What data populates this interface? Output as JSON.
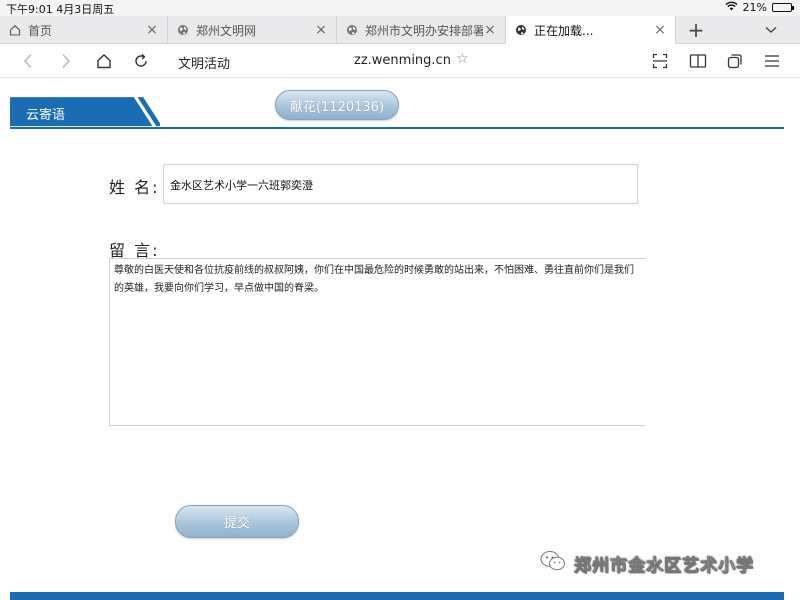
{
  "status_bar": {
    "time_date": "下午9:01   4月3日周五",
    "battery": "21%",
    "battery_level": 0.21
  },
  "tabs": [
    {
      "title": "首页",
      "icon": "home-icon",
      "active": false
    },
    {
      "title": "郑州文明网",
      "icon": "globe-icon",
      "active": false
    },
    {
      "title": "郑州市文明办安排部署",
      "icon": "globe-icon",
      "active": false
    },
    {
      "title": "正在加载...",
      "icon": "globe-icon",
      "active": true
    }
  ],
  "toolbar": {
    "page_name": "文明活动",
    "url": "zz.wenming.cn"
  },
  "page": {
    "section_tab": "云寄语",
    "flower_button": "献花(1120136)",
    "name_label": "姓 名:",
    "name_value": "金水区艺术小学一六班郭奕澄",
    "message_label": "留 言:",
    "message_value": "尊敬的白医天使和各位抗疫前线的叔叔阿姨，你们在中国最危险的时候勇敢的站出来，不怕困难、勇往直前你们是我们的英雄，我要向你们学习，早点做中国的脊梁。",
    "submit_button": "提交"
  },
  "watermark": {
    "text": "郑州市金水区艺术小学"
  },
  "colors": {
    "brand_blue": "#1a6db2",
    "button_blue": "#a9c5dc"
  }
}
